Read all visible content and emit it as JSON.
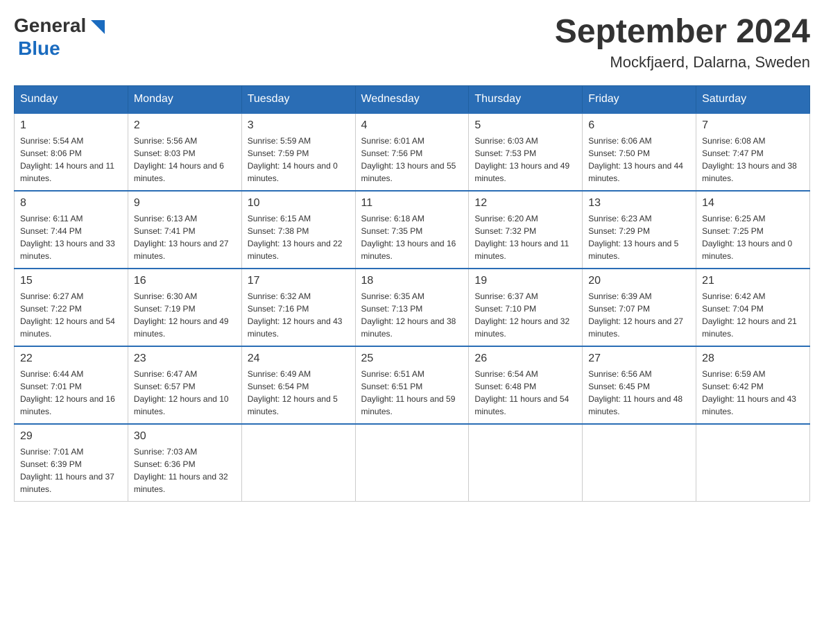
{
  "header": {
    "logo": {
      "text_general": "General",
      "text_blue": "Blue",
      "aria": "GeneralBlue Logo"
    },
    "title": "September 2024",
    "subtitle": "Mockfjaerd, Dalarna, Sweden"
  },
  "days_of_week": [
    "Sunday",
    "Monday",
    "Tuesday",
    "Wednesday",
    "Thursday",
    "Friday",
    "Saturday"
  ],
  "weeks": [
    [
      {
        "day": "1",
        "sunrise": "Sunrise: 5:54 AM",
        "sunset": "Sunset: 8:06 PM",
        "daylight": "Daylight: 14 hours and 11 minutes."
      },
      {
        "day": "2",
        "sunrise": "Sunrise: 5:56 AM",
        "sunset": "Sunset: 8:03 PM",
        "daylight": "Daylight: 14 hours and 6 minutes."
      },
      {
        "day": "3",
        "sunrise": "Sunrise: 5:59 AM",
        "sunset": "Sunset: 7:59 PM",
        "daylight": "Daylight: 14 hours and 0 minutes."
      },
      {
        "day": "4",
        "sunrise": "Sunrise: 6:01 AM",
        "sunset": "Sunset: 7:56 PM",
        "daylight": "Daylight: 13 hours and 55 minutes."
      },
      {
        "day": "5",
        "sunrise": "Sunrise: 6:03 AM",
        "sunset": "Sunset: 7:53 PM",
        "daylight": "Daylight: 13 hours and 49 minutes."
      },
      {
        "day": "6",
        "sunrise": "Sunrise: 6:06 AM",
        "sunset": "Sunset: 7:50 PM",
        "daylight": "Daylight: 13 hours and 44 minutes."
      },
      {
        "day": "7",
        "sunrise": "Sunrise: 6:08 AM",
        "sunset": "Sunset: 7:47 PM",
        "daylight": "Daylight: 13 hours and 38 minutes."
      }
    ],
    [
      {
        "day": "8",
        "sunrise": "Sunrise: 6:11 AM",
        "sunset": "Sunset: 7:44 PM",
        "daylight": "Daylight: 13 hours and 33 minutes."
      },
      {
        "day": "9",
        "sunrise": "Sunrise: 6:13 AM",
        "sunset": "Sunset: 7:41 PM",
        "daylight": "Daylight: 13 hours and 27 minutes."
      },
      {
        "day": "10",
        "sunrise": "Sunrise: 6:15 AM",
        "sunset": "Sunset: 7:38 PM",
        "daylight": "Daylight: 13 hours and 22 minutes."
      },
      {
        "day": "11",
        "sunrise": "Sunrise: 6:18 AM",
        "sunset": "Sunset: 7:35 PM",
        "daylight": "Daylight: 13 hours and 16 minutes."
      },
      {
        "day": "12",
        "sunrise": "Sunrise: 6:20 AM",
        "sunset": "Sunset: 7:32 PM",
        "daylight": "Daylight: 13 hours and 11 minutes."
      },
      {
        "day": "13",
        "sunrise": "Sunrise: 6:23 AM",
        "sunset": "Sunset: 7:29 PM",
        "daylight": "Daylight: 13 hours and 5 minutes."
      },
      {
        "day": "14",
        "sunrise": "Sunrise: 6:25 AM",
        "sunset": "Sunset: 7:25 PM",
        "daylight": "Daylight: 13 hours and 0 minutes."
      }
    ],
    [
      {
        "day": "15",
        "sunrise": "Sunrise: 6:27 AM",
        "sunset": "Sunset: 7:22 PM",
        "daylight": "Daylight: 12 hours and 54 minutes."
      },
      {
        "day": "16",
        "sunrise": "Sunrise: 6:30 AM",
        "sunset": "Sunset: 7:19 PM",
        "daylight": "Daylight: 12 hours and 49 minutes."
      },
      {
        "day": "17",
        "sunrise": "Sunrise: 6:32 AM",
        "sunset": "Sunset: 7:16 PM",
        "daylight": "Daylight: 12 hours and 43 minutes."
      },
      {
        "day": "18",
        "sunrise": "Sunrise: 6:35 AM",
        "sunset": "Sunset: 7:13 PM",
        "daylight": "Daylight: 12 hours and 38 minutes."
      },
      {
        "day": "19",
        "sunrise": "Sunrise: 6:37 AM",
        "sunset": "Sunset: 7:10 PM",
        "daylight": "Daylight: 12 hours and 32 minutes."
      },
      {
        "day": "20",
        "sunrise": "Sunrise: 6:39 AM",
        "sunset": "Sunset: 7:07 PM",
        "daylight": "Daylight: 12 hours and 27 minutes."
      },
      {
        "day": "21",
        "sunrise": "Sunrise: 6:42 AM",
        "sunset": "Sunset: 7:04 PM",
        "daylight": "Daylight: 12 hours and 21 minutes."
      }
    ],
    [
      {
        "day": "22",
        "sunrise": "Sunrise: 6:44 AM",
        "sunset": "Sunset: 7:01 PM",
        "daylight": "Daylight: 12 hours and 16 minutes."
      },
      {
        "day": "23",
        "sunrise": "Sunrise: 6:47 AM",
        "sunset": "Sunset: 6:57 PM",
        "daylight": "Daylight: 12 hours and 10 minutes."
      },
      {
        "day": "24",
        "sunrise": "Sunrise: 6:49 AM",
        "sunset": "Sunset: 6:54 PM",
        "daylight": "Daylight: 12 hours and 5 minutes."
      },
      {
        "day": "25",
        "sunrise": "Sunrise: 6:51 AM",
        "sunset": "Sunset: 6:51 PM",
        "daylight": "Daylight: 11 hours and 59 minutes."
      },
      {
        "day": "26",
        "sunrise": "Sunrise: 6:54 AM",
        "sunset": "Sunset: 6:48 PM",
        "daylight": "Daylight: 11 hours and 54 minutes."
      },
      {
        "day": "27",
        "sunrise": "Sunrise: 6:56 AM",
        "sunset": "Sunset: 6:45 PM",
        "daylight": "Daylight: 11 hours and 48 minutes."
      },
      {
        "day": "28",
        "sunrise": "Sunrise: 6:59 AM",
        "sunset": "Sunset: 6:42 PM",
        "daylight": "Daylight: 11 hours and 43 minutes."
      }
    ],
    [
      {
        "day": "29",
        "sunrise": "Sunrise: 7:01 AM",
        "sunset": "Sunset: 6:39 PM",
        "daylight": "Daylight: 11 hours and 37 minutes."
      },
      {
        "day": "30",
        "sunrise": "Sunrise: 7:03 AM",
        "sunset": "Sunset: 6:36 PM",
        "daylight": "Daylight: 11 hours and 32 minutes."
      },
      null,
      null,
      null,
      null,
      null
    ]
  ]
}
